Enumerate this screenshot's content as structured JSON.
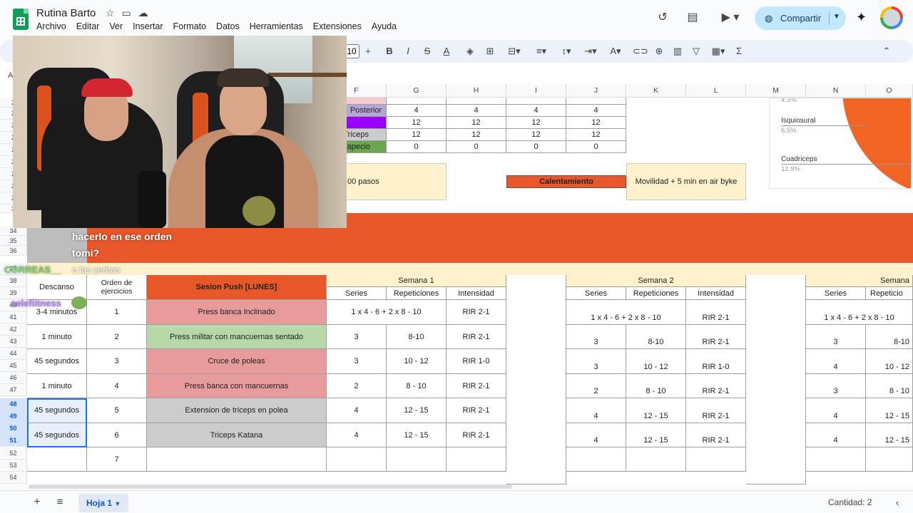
{
  "header": {
    "doc_title": "Rutina Barto",
    "menu": [
      "Archivo",
      "Editar",
      "Ver",
      "Insertar",
      "Formato",
      "Datos",
      "Herramientas",
      "Extensiones",
      "Ayuda"
    ],
    "share_label": "Compartir"
  },
  "toolbar": {
    "font_size": "10"
  },
  "namebox": "A",
  "columns": [
    "F",
    "G",
    "H",
    "I",
    "J",
    "K",
    "L",
    "M",
    "N",
    "O"
  ],
  "rows_top": [
    "2",
    "2",
    "2",
    "2",
    "2",
    "2",
    "2",
    "2",
    "2",
    "3"
  ],
  "rows_bottom": [
    "34",
    "35",
    "36",
    "37",
    "38",
    "39",
    "40",
    "41",
    "42",
    "43",
    "44",
    "45",
    "46",
    "47",
    "48",
    "49",
    "50",
    "51",
    "52",
    "53",
    "54"
  ],
  "muscles": [
    {
      "name": "Posterior",
      "values": [
        "4",
        "4",
        "4",
        "4"
      ]
    },
    {
      "name": "",
      "values": [
        "12",
        "12",
        "12",
        "12"
      ]
    },
    {
      "name": "Triceps",
      "values": [
        "12",
        "12",
        "12",
        "12"
      ]
    },
    {
      "name": "rapecio",
      "values": [
        "0",
        "0",
        "0",
        "0"
      ]
    }
  ],
  "pasos_text": "00 pasos",
  "calentamiento_label": "Calentamiento",
  "calentamiento_value": "Movilidad + 5 min en air byke",
  "chart_labels": {
    "top_pct": "4.3%",
    "isquio": "Isquiosural",
    "isquio_pct": "6.5%",
    "cuad": "Cuadriceps",
    "cuad_pct": "12.9%"
  },
  "table": {
    "h_descanso": "Descanso",
    "h_orden": "Orden de ejercicios",
    "h_sesion": "Sesion Push [LUNES]",
    "semanas": [
      "Semana 1",
      "Semana 2",
      "Semana"
    ],
    "sub": [
      "Series",
      "Repeticiones",
      "Intensidad"
    ],
    "sub_short": "Repeticio",
    "rows": [
      {
        "descanso": "3-4 minutos",
        "orden": "1",
        "ejercicio": "Press banca Inclinado",
        "s1": [
          "1 x 4 - 6 + 2 x 8 - 10",
          "RIR 2-1"
        ],
        "s2": [
          "1 x 4 - 6 + 2 x 8 - 10",
          "RIR 2-1"
        ],
        "s3": [
          "1 x 4 - 6 + 2 x 8 - 10"
        ]
      },
      {
        "descanso": "1 minuto",
        "orden": "2",
        "ejercicio": "Press militar con mancuernas sentado",
        "s1": [
          "3",
          "8-10",
          "RIR 2-1"
        ],
        "s2": [
          "3",
          "8-10",
          "RIR 2-1"
        ],
        "s3": [
          "3",
          "8-10"
        ]
      },
      {
        "descanso": "45 segundos",
        "orden": "3",
        "ejercicio": "Cruce de poleas",
        "s1": [
          "3",
          "10 - 12",
          "RIR 1-0"
        ],
        "s2": [
          "3",
          "10 - 12",
          "RIR 1-0"
        ],
        "s3": [
          "4",
          "10 - 12"
        ]
      },
      {
        "descanso": "1 minuto",
        "orden": "4",
        "ejercicio": "Press banca con mancuernas",
        "s1": [
          "2",
          "8 - 10",
          "RIR 2-1"
        ],
        "s2": [
          "2",
          "8 - 10",
          "RIR 2-1"
        ],
        "s3": [
          "3",
          "8 - 10"
        ]
      },
      {
        "descanso": "45 segundos",
        "orden": "5",
        "ejercicio": "Extension de triceps en polea",
        "s1": [
          "4",
          "12 - 15",
          "RIR 2-1"
        ],
        "s2": [
          "4",
          "12 - 15",
          "RIR 2-1"
        ],
        "s3": [
          "4",
          "12 - 15"
        ]
      },
      {
        "descanso": "45 segundos",
        "orden": "6",
        "ejercicio": "Triceps Katana",
        "s1": [
          "4",
          "12 - 15",
          "RIR 2-1"
        ],
        "s2": [
          "4",
          "12 - 15",
          "RIR 2-1"
        ],
        "s3": [
          "4",
          "12 - 15"
        ]
      },
      {
        "descanso": "",
        "orden": "7",
        "ejercicio": "",
        "s1": [
          "",
          "",
          ""
        ],
        "s2": [
          "",
          "",
          ""
        ],
        "s3": [
          "",
          ""
        ]
      }
    ]
  },
  "chat": {
    "line1": "hacerlo en ese orden",
    "line2": "tomi?",
    "user1": "CORREAS__",
    "msg1": "o las yerbas",
    "user2": "selefiitness"
  },
  "bottom": {
    "sheet_name": "Hoja 1",
    "count": "Cantidad: 2"
  },
  "colors": {
    "accent": "#e8572a",
    "share_bg": "#c2e7ff",
    "red_row": "#e89b9b",
    "green_row": "#b6d7a8",
    "gray_row": "#cccccc",
    "yellow": "#fff2cc"
  }
}
